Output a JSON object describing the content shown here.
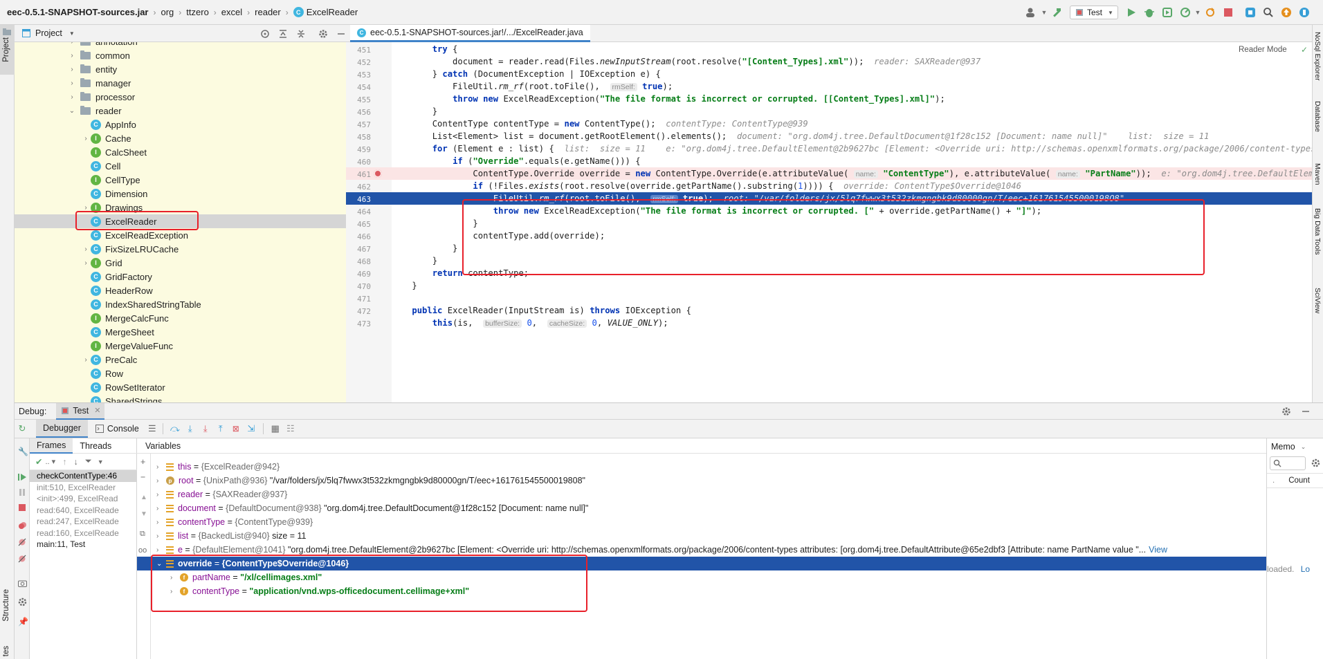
{
  "navbar": {
    "crumbs": [
      "eec-0.5.1-SNAPSHOT-sources.jar",
      "org",
      "ttzero",
      "excel",
      "reader",
      "ExcelReader"
    ],
    "run_config": "Test"
  },
  "left_stripe": {
    "project": "Project",
    "structure": "Structure",
    "favorites": "tes"
  },
  "right_stripe": {
    "items": [
      "NoSql Explorer",
      "Database",
      "Maven",
      "Big Data Tools",
      "SciView"
    ]
  },
  "project_panel": {
    "title": "Project",
    "tree": [
      {
        "label": "annotation",
        "kind": "folder",
        "depth": 0,
        "arrow": "right"
      },
      {
        "label": "common",
        "kind": "folder",
        "depth": 0,
        "arrow": "right"
      },
      {
        "label": "entity",
        "kind": "folder",
        "depth": 0,
        "arrow": "right"
      },
      {
        "label": "manager",
        "kind": "folder",
        "depth": 0,
        "arrow": "right"
      },
      {
        "label": "processor",
        "kind": "folder",
        "depth": 0,
        "arrow": "right"
      },
      {
        "label": "reader",
        "kind": "folder",
        "depth": 0,
        "arrow": "down"
      },
      {
        "label": "AppInfo",
        "kind": "c",
        "depth": 1,
        "arrow": ""
      },
      {
        "label": "Cache",
        "kind": "i",
        "depth": 1,
        "arrow": "right"
      },
      {
        "label": "CalcSheet",
        "kind": "i",
        "depth": 1,
        "arrow": ""
      },
      {
        "label": "Cell",
        "kind": "c",
        "depth": 1,
        "arrow": ""
      },
      {
        "label": "CellType",
        "kind": "i",
        "depth": 1,
        "arrow": ""
      },
      {
        "label": "Dimension",
        "kind": "c",
        "depth": 1,
        "arrow": ""
      },
      {
        "label": "Drawings",
        "kind": "i",
        "depth": 1,
        "arrow": "right"
      },
      {
        "label": "ExcelReader",
        "kind": "c",
        "depth": 1,
        "arrow": "",
        "selected": true
      },
      {
        "label": "ExcelReadException",
        "kind": "c",
        "depth": 1,
        "arrow": ""
      },
      {
        "label": "FixSizeLRUCache",
        "kind": "c",
        "depth": 1,
        "arrow": "right"
      },
      {
        "label": "Grid",
        "kind": "i",
        "depth": 1,
        "arrow": "right"
      },
      {
        "label": "GridFactory",
        "kind": "c",
        "depth": 1,
        "arrow": ""
      },
      {
        "label": "HeaderRow",
        "kind": "c",
        "depth": 1,
        "arrow": ""
      },
      {
        "label": "IndexSharedStringTable",
        "kind": "c",
        "depth": 1,
        "arrow": ""
      },
      {
        "label": "MergeCalcFunc",
        "kind": "i",
        "depth": 1,
        "arrow": ""
      },
      {
        "label": "MergeSheet",
        "kind": "c",
        "depth": 1,
        "arrow": ""
      },
      {
        "label": "MergeValueFunc",
        "kind": "i",
        "depth": 1,
        "arrow": ""
      },
      {
        "label": "PreCalc",
        "kind": "c",
        "depth": 1,
        "arrow": "right"
      },
      {
        "label": "Row",
        "kind": "c",
        "depth": 1,
        "arrow": ""
      },
      {
        "label": "RowSetIterator",
        "kind": "c",
        "depth": 1,
        "arrow": ""
      },
      {
        "label": "SharedStrings",
        "kind": "c",
        "depth": 1,
        "arrow": ""
      }
    ]
  },
  "editor": {
    "tab": "eec-0.5.1-SNAPSHOT-sources.jar!/.../ExcelReader.java",
    "reader_mode": "Reader Mode",
    "line_numbers": [
      "451",
      "452",
      "453",
      "454",
      "455",
      "456",
      "457",
      "458",
      "459",
      "460",
      "461",
      "462",
      "463",
      "464",
      "465",
      "466",
      "467",
      "468",
      "469",
      "470",
      "471",
      "472",
      "473"
    ],
    "lines": [
      {
        "t": [
          [
            "        ",
            ""
          ],
          [
            "try",
            "kw"
          ],
          [
            " {",
            ""
          ]
        ]
      },
      {
        "t": [
          [
            "            document = reader.read(Files.",
            ""
          ],
          [
            "newInputStream",
            "it"
          ],
          [
            "(root.resolve(",
            ""
          ],
          [
            "\"[Content_Types].xml\"",
            "str"
          ],
          [
            "));  ",
            ""
          ],
          [
            "reader: SAXReader@937",
            "hint"
          ]
        ]
      },
      {
        "t": [
          [
            "        } ",
            ""
          ],
          [
            "catch",
            "kw"
          ],
          [
            " (DocumentException | IOException e) {",
            ""
          ]
        ]
      },
      {
        "t": [
          [
            "            FileUtil.",
            ""
          ],
          [
            "rm_rf",
            "it"
          ],
          [
            "(root.toFile(),  ",
            ""
          ],
          [
            "rmSelf:",
            "pl"
          ],
          [
            " ",
            ""
          ],
          [
            "true",
            "kw"
          ],
          [
            ");",
            ""
          ]
        ]
      },
      {
        "t": [
          [
            "            ",
            ""
          ],
          [
            "throw new",
            "kw"
          ],
          [
            " ExcelReadException(",
            ""
          ],
          [
            "\"The file format is incorrect or corrupted. [[Content_Types].xml]\"",
            "str"
          ],
          [
            ");",
            ""
          ]
        ]
      },
      {
        "t": [
          [
            "        }",
            ""
          ]
        ]
      },
      {
        "t": [
          [
            "        ContentType contentType = ",
            ""
          ],
          [
            "new",
            "kw"
          ],
          [
            " ContentType();  ",
            ""
          ],
          [
            "contentType: ContentType@939",
            "hint"
          ]
        ]
      },
      {
        "t": [
          [
            "        List<Element> list = document.getRootElement().elements();  ",
            ""
          ],
          [
            "document: \"org.dom4j.tree.DefaultDocument@1f28c152 [Document: name null]\"    list:  size = 11",
            "hint"
          ]
        ]
      },
      {
        "t": [
          [
            "        ",
            ""
          ],
          [
            "for",
            "kw"
          ],
          [
            " (Element e : list) {  ",
            ""
          ],
          [
            "list:  size = 11    e: \"org.dom4j.tree.DefaultElement@2b9627bc [Element: <Override uri: http://schemas.openxmlformats.org/package/2006/content-types",
            "hint"
          ]
        ]
      },
      {
        "t": [
          [
            "            ",
            ""
          ],
          [
            "if",
            "kw"
          ],
          [
            " (",
            ""
          ],
          [
            "\"Override\"",
            "str"
          ],
          [
            ".equals(e.getName())) {",
            ""
          ]
        ]
      },
      {
        "t": [
          [
            "                ContentType.Override override = ",
            ""
          ],
          [
            "new",
            "kw"
          ],
          [
            " ContentType.Override(e.attributeValue( ",
            ""
          ],
          [
            "name:",
            "pl"
          ],
          [
            " ",
            ""
          ],
          [
            "\"ContentType\"",
            "str"
          ],
          [
            "), e.attributeValue( ",
            ""
          ],
          [
            "name:",
            "pl"
          ],
          [
            " ",
            ""
          ],
          [
            "\"PartName\"",
            "str"
          ],
          [
            "));  ",
            ""
          ],
          [
            "e: \"org.dom4j.tree.DefaultElement",
            "hint"
          ]
        ],
        "bp": true
      },
      {
        "t": [
          [
            "                ",
            ""
          ],
          [
            "if",
            "kw"
          ],
          [
            " (!Files.",
            ""
          ],
          [
            "exists",
            "it"
          ],
          [
            "(root.resolve(override.getPartName().substring(",
            ""
          ],
          [
            "1",
            "num"
          ],
          [
            ")))) {  ",
            ""
          ],
          [
            "override: ContentType$Override@1046",
            "hint"
          ]
        ]
      },
      {
        "t": [
          [
            "                    FileUtil.",
            ""
          ],
          [
            "rm_rf",
            "it"
          ],
          [
            "(root.toFile(),  ",
            ""
          ],
          [
            "rmSelf:",
            "pl"
          ],
          [
            " ",
            ""
          ],
          [
            "true",
            "kw"
          ],
          [
            ");  ",
            ""
          ],
          [
            "root: \"/var/folders/jx/5lq7fwwx3t532zkmgngbk9d80000gn/T/eec+1617615455000198O8\"",
            "hint"
          ]
        ],
        "sel": true
      },
      {
        "t": [
          [
            "                    ",
            ""
          ],
          [
            "throw new",
            "kw"
          ],
          [
            " ExcelReadException(",
            ""
          ],
          [
            "\"The file format is incorrect or corrupted. [\"",
            "str"
          ],
          [
            " + override.getPartName() + ",
            ""
          ],
          [
            "\"]\"",
            "str"
          ],
          [
            ");",
            ""
          ]
        ]
      },
      {
        "t": [
          [
            "                }",
            ""
          ]
        ]
      },
      {
        "t": [
          [
            "                contentType.add(override);",
            ""
          ]
        ]
      },
      {
        "t": [
          [
            "            }",
            ""
          ]
        ]
      },
      {
        "t": [
          [
            "        }",
            ""
          ]
        ]
      },
      {
        "t": [
          [
            "        ",
            ""
          ],
          [
            "return",
            "kw"
          ],
          [
            " contentType;",
            ""
          ]
        ]
      },
      {
        "t": [
          [
            "    }",
            ""
          ]
        ]
      },
      {
        "t": [
          [
            "",
            ""
          ]
        ]
      },
      {
        "t": [
          [
            "    ",
            ""
          ],
          [
            "public",
            "kw"
          ],
          [
            " ExcelReader(InputStream is) ",
            ""
          ],
          [
            "throws",
            "kw"
          ],
          [
            " IOException {",
            ""
          ]
        ]
      },
      {
        "t": [
          [
            "        ",
            ""
          ],
          [
            "this",
            "kw"
          ],
          [
            "(is,  ",
            ""
          ],
          [
            "bufferSize:",
            "pl"
          ],
          [
            " ",
            ""
          ],
          [
            "0",
            "num"
          ],
          [
            ",  ",
            ""
          ],
          [
            "cacheSize:",
            "pl"
          ],
          [
            " ",
            ""
          ],
          [
            "0",
            "num"
          ],
          [
            ", ",
            ""
          ],
          [
            "VALUE_ONLY",
            "it"
          ],
          [
            ");",
            ""
          ]
        ]
      }
    ]
  },
  "debug": {
    "title": "Debug:",
    "session_tab": "Test",
    "tabs": [
      "Debugger",
      "Console"
    ],
    "frames_tab": "Frames",
    "threads_tab": "Threads",
    "variables_tab": "Variables",
    "memory_tab": "Memo",
    "count_label": "Count",
    "loaded_text": "loaded.",
    "loaded_link": "Lo",
    "frames": [
      "checkContentType:46",
      "init:510, ExcelReader",
      "<init>:499, ExcelRead",
      "read:640, ExcelReade",
      "read:247, ExcelReade",
      "read:160, ExcelReade",
      "main:11, Test"
    ],
    "variables": [
      {
        "icon": "list",
        "name": "this",
        "type": "{ExcelReader@942}",
        "value": "",
        "depth": 0
      },
      {
        "icon": "p",
        "name": "root",
        "type": "{UnixPath@936}",
        "value": "\"/var/folders/jx/5lq7fwwx3t532zkmgngbk9d80000gn/T/eec+161761545500019808\"",
        "depth": 0
      },
      {
        "icon": "list",
        "name": "reader",
        "type": "{SAXReader@937}",
        "value": "",
        "depth": 0
      },
      {
        "icon": "list",
        "name": "document",
        "type": "{DefaultDocument@938}",
        "value": "\"org.dom4j.tree.DefaultDocument@1f28c152 [Document: name null]\"",
        "depth": 0
      },
      {
        "icon": "list",
        "name": "contentType",
        "type": "{ContentType@939}",
        "value": "",
        "depth": 0
      },
      {
        "icon": "list",
        "name": "list",
        "type": "{BackedList@940}",
        "value": " size = 11",
        "depth": 0
      },
      {
        "icon": "list",
        "name": "e",
        "type": "{DefaultElement@1041}",
        "value": "\"org.dom4j.tree.DefaultElement@2b9627bc [Element: <Override uri: http://schemas.openxmlformats.org/package/2006/content-types attributes: [org.dom4j.tree.DefaultAttribute@65e2dbf3 [Attribute: name PartName value \"...",
        "depth": 0,
        "link": "View"
      },
      {
        "icon": "list",
        "name": "override",
        "type": "{ContentType$Override@1046}",
        "value": "",
        "depth": 0,
        "selected": true,
        "open": true
      },
      {
        "icon": "f",
        "name": "partName",
        "type": "",
        "value": "\"/xl/cellimages.xml\"",
        "depth": 1
      },
      {
        "icon": "f",
        "name": "contentType",
        "type": "",
        "value": "\"application/vnd.wps-officedocument.cellimage+xml\"",
        "depth": 1
      }
    ]
  },
  "colors": {
    "accent": "#2154a8",
    "highlight_box": "#e8202a",
    "tree_bg": "#fcfbe0"
  }
}
